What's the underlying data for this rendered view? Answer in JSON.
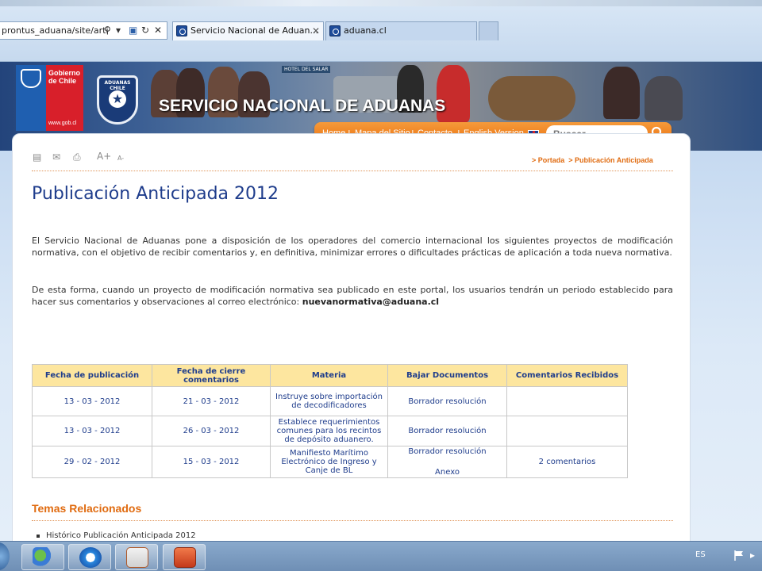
{
  "browser": {
    "address": "prontus_aduana/site/arti",
    "tabs": [
      {
        "label": "Servicio Nacional de Aduan..."
      },
      {
        "label": "aduana.cl"
      }
    ]
  },
  "header": {
    "gob_logo_text": "Gobierno de Chile",
    "gob_url": "www.gob.cl",
    "aduana_logo_text": "ADUANAS CHILE",
    "sign_text": "HOTEL DEL SALAR",
    "site_title": "SERVICIO NACIONAL DE ADUANAS",
    "nav": {
      "home": "Home",
      "sitemap": "Mapa del Sitio",
      "contact": "Contacto",
      "english": "English Version",
      "separator": "|"
    },
    "search_placeholder": "Buscar..."
  },
  "toolbar": {
    "font_increase": "A+",
    "font_decrease": "A-"
  },
  "breadcrumb": {
    "home": "> Portada",
    "current": "> Publicación Anticipada"
  },
  "page_title": "Publicación Anticipada 2012",
  "paragraphs": {
    "p1": "El Servicio Nacional de Aduanas pone a disposición de los operadores del comercio internacional los siguientes proyectos de modificación normativa, con el objetivo de recibir comentarios y, en definitiva, minimizar errores o dificultades prácticas de aplicación a toda nueva normativa.",
    "p2": "De esta forma, cuando un proyecto de modificación normativa sea publicado en este portal, los usuarios tendrán un periodo establecido para hacer sus comentarios y observaciones al correo electrónico:",
    "email": "nuevanormativa@aduana.cl"
  },
  "table": {
    "headers": [
      "Fecha de publicación",
      "Fecha de cierre comentarios",
      "Materia",
      "Bajar Documentos",
      "Comentarios Recibidos"
    ],
    "rows": [
      {
        "pub": "13 - 03 - 2012",
        "close": "21 - 03 - 2012",
        "subject": "Instruye sobre importación de decodificadores",
        "doc": "Borrador resolución",
        "doc2": "",
        "comments": ""
      },
      {
        "pub": "13 - 03 - 2012",
        "close": "26 - 03 - 2012",
        "subject": "Establece requerimientos comunes para los recintos de depósito aduanero.",
        "doc": "Borrador resolución",
        "doc2": "",
        "comments": ""
      },
      {
        "pub": "29 - 02 - 2012",
        "close": "15 - 03 - 2012",
        "subject": "Manifiesto Marítimo Electrónico de Ingreso y Canje de BL",
        "doc": "Borrador resolución",
        "doc2": "Anexo",
        "comments": "2 comentarios"
      }
    ]
  },
  "related": {
    "title": "Temas Relacionados",
    "items": [
      "Histórico Publicación Anticipada 2012"
    ]
  },
  "taskbar": {
    "language": "ES"
  },
  "colors": {
    "accent_orange": "#ea6f0e",
    "title_blue": "#1f3d8c",
    "table_header": "#fde69f"
  }
}
